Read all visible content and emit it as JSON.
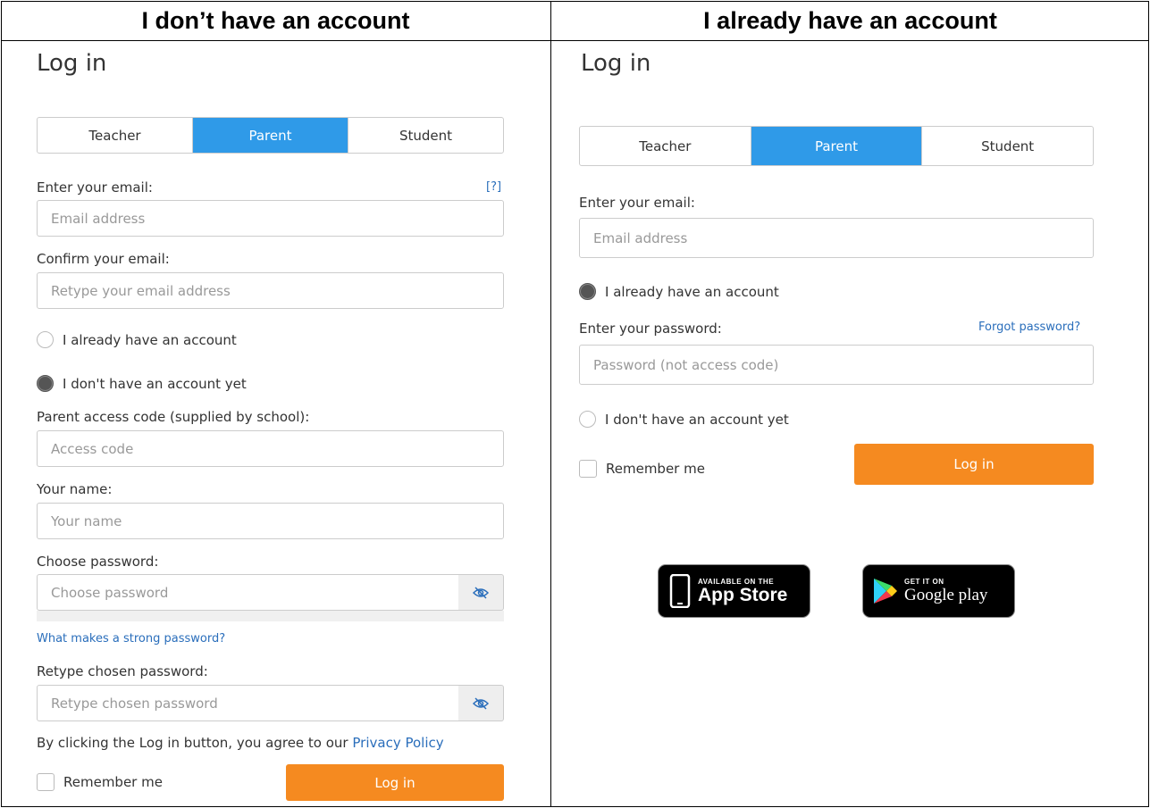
{
  "headers": {
    "left": "I don’t have an account",
    "right": "I already have an account"
  },
  "left_panel": {
    "title": "Log in",
    "tabs": [
      {
        "label": "Teacher",
        "active": false
      },
      {
        "label": "Parent",
        "active": true
      },
      {
        "label": "Student",
        "active": false
      }
    ],
    "email_label": "Enter your email:",
    "help_link": "[?]",
    "email_placeholder": "Email address",
    "confirm_label": "Confirm your email:",
    "confirm_placeholder": "Retype your email address",
    "radio_have_account": {
      "label": "I already have an account",
      "checked": false
    },
    "radio_no_account": {
      "label": "I don't have an account yet",
      "checked": true
    },
    "access_code_label": "Parent access code (supplied by school):",
    "access_code_placeholder": "Access code",
    "name_label": "Your name:",
    "name_placeholder": "Your name",
    "password_label": "Choose password:",
    "password_placeholder": "Choose password",
    "strong_password_link": "What makes a strong password?",
    "retype_label": "Retype chosen password:",
    "retype_placeholder": "Retype chosen password",
    "agree_text": "By clicking the Log in button, you agree to our",
    "privacy_link": "Privacy Policy",
    "remember_label": "Remember me",
    "remember_checked": false,
    "login_button": "Log in"
  },
  "right_panel": {
    "title": "Log in",
    "tabs": [
      {
        "label": "Teacher",
        "active": false
      },
      {
        "label": "Parent",
        "active": true
      },
      {
        "label": "Student",
        "active": false
      }
    ],
    "email_label": "Enter your email:",
    "email_placeholder": "Email address",
    "radio_have_account": {
      "label": "I already have an account",
      "checked": true
    },
    "password_label": "Enter your password:",
    "forgot_link": "Forgot password?",
    "password_placeholder": "Password (not access code)",
    "radio_no_account": {
      "label": "I don't have an account yet",
      "checked": false
    },
    "remember_label": "Remember me",
    "remember_checked": false,
    "login_button": "Log in",
    "app_store": {
      "small": "AVAILABLE ON THE",
      "big": "App Store",
      "icon": "phone-icon"
    },
    "google_play": {
      "small": "GET IT ON",
      "big": "Google play",
      "icon": "play-triangle-icon"
    }
  },
  "colors": {
    "accent_blue": "#2f9ae8",
    "login_orange": "#f58a20",
    "link_blue": "#2a6ebb"
  }
}
